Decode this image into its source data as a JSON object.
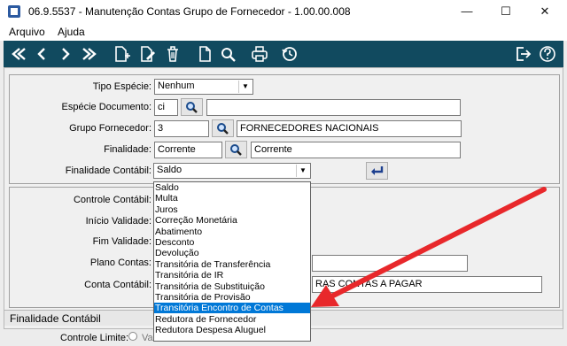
{
  "window": {
    "title": "06.9.5537 - Manutenção Contas Grupo de Fornecedor - 1.00.00.008",
    "minimize": "—",
    "maximize": "☐",
    "close": "✕"
  },
  "menu": {
    "items": [
      "Arquivo",
      "Ajuda"
    ]
  },
  "toolbar": {
    "icons": [
      "first-icon",
      "prev-icon",
      "next-icon",
      "last-icon",
      "new-record-icon",
      "edit-icon",
      "delete-icon",
      "document-icon",
      "search-icon",
      "print-icon",
      "history-icon",
      "exit-icon",
      "help-icon"
    ]
  },
  "form": {
    "tipo_especie": {
      "label": "Tipo Espécie:",
      "value": "Nenhum"
    },
    "especie_documento": {
      "label": "Espécie Documento:",
      "value": "ci",
      "description": ""
    },
    "grupo_fornecedor": {
      "label": "Grupo Fornecedor:",
      "value": "3",
      "description": "FORNECEDORES NACIONAIS"
    },
    "finalidade": {
      "label": "Finalidade:",
      "value": "Corrente",
      "description": "Corrente"
    },
    "finalidade_contabil": {
      "label": "Finalidade Contábil:",
      "value": "Saldo"
    },
    "controle_contabil": {
      "label": "Controle Contábil:"
    },
    "inicio_validade": {
      "label": "Início Validade:"
    },
    "fim_validade": {
      "label": "Fim Validade:"
    },
    "plano_contas": {
      "label": "Plano Contas:"
    },
    "conta_contabil": {
      "label": "Conta Contábil:",
      "description": "RAS CONTAS A PAGAR"
    }
  },
  "status_bar": {
    "text": "Finalidade Contábil"
  },
  "bottom": {
    "controle_limite_label": "Controle Limite:",
    "controle_limite_value": "Va"
  },
  "dropdown": {
    "options": [
      "Saldo",
      "Multa",
      "Juros",
      "Correção Monetária",
      "Abatimento",
      "Desconto",
      "Devolução",
      "Transitória de Transferência",
      "Transitória de IR",
      "Transitória de Substituição",
      "Transitória de Provisão",
      "Transitória Encontro de Contas",
      "Redutora de Fornecedor",
      "Redutora Despesa Aluguel"
    ],
    "selected": "Transitória Encontro de Contas"
  },
  "colors": {
    "toolbar": "#114a5f",
    "selection": "#0078d7",
    "annotation_arrow": "#e8282b"
  }
}
